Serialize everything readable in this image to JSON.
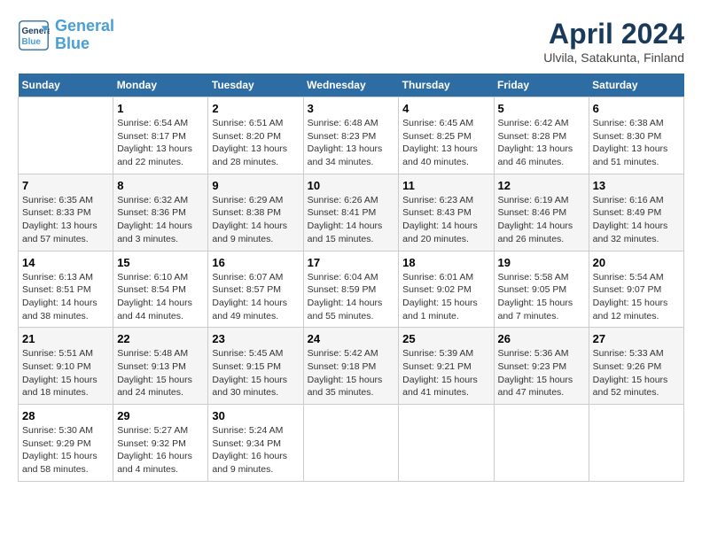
{
  "logo": {
    "line1": "General",
    "line2": "Blue"
  },
  "title": "April 2024",
  "subtitle": "Ulvila, Satakunta, Finland",
  "days_header": [
    "Sunday",
    "Monday",
    "Tuesday",
    "Wednesday",
    "Thursday",
    "Friday",
    "Saturday"
  ],
  "weeks": [
    [
      {
        "num": "",
        "info": ""
      },
      {
        "num": "1",
        "info": "Sunrise: 6:54 AM\nSunset: 8:17 PM\nDaylight: 13 hours\nand 22 minutes."
      },
      {
        "num": "2",
        "info": "Sunrise: 6:51 AM\nSunset: 8:20 PM\nDaylight: 13 hours\nand 28 minutes."
      },
      {
        "num": "3",
        "info": "Sunrise: 6:48 AM\nSunset: 8:23 PM\nDaylight: 13 hours\nand 34 minutes."
      },
      {
        "num": "4",
        "info": "Sunrise: 6:45 AM\nSunset: 8:25 PM\nDaylight: 13 hours\nand 40 minutes."
      },
      {
        "num": "5",
        "info": "Sunrise: 6:42 AM\nSunset: 8:28 PM\nDaylight: 13 hours\nand 46 minutes."
      },
      {
        "num": "6",
        "info": "Sunrise: 6:38 AM\nSunset: 8:30 PM\nDaylight: 13 hours\nand 51 minutes."
      }
    ],
    [
      {
        "num": "7",
        "info": "Sunrise: 6:35 AM\nSunset: 8:33 PM\nDaylight: 13 hours\nand 57 minutes."
      },
      {
        "num": "8",
        "info": "Sunrise: 6:32 AM\nSunset: 8:36 PM\nDaylight: 14 hours\nand 3 minutes."
      },
      {
        "num": "9",
        "info": "Sunrise: 6:29 AM\nSunset: 8:38 PM\nDaylight: 14 hours\nand 9 minutes."
      },
      {
        "num": "10",
        "info": "Sunrise: 6:26 AM\nSunset: 8:41 PM\nDaylight: 14 hours\nand 15 minutes."
      },
      {
        "num": "11",
        "info": "Sunrise: 6:23 AM\nSunset: 8:43 PM\nDaylight: 14 hours\nand 20 minutes."
      },
      {
        "num": "12",
        "info": "Sunrise: 6:19 AM\nSunset: 8:46 PM\nDaylight: 14 hours\nand 26 minutes."
      },
      {
        "num": "13",
        "info": "Sunrise: 6:16 AM\nSunset: 8:49 PM\nDaylight: 14 hours\nand 32 minutes."
      }
    ],
    [
      {
        "num": "14",
        "info": "Sunrise: 6:13 AM\nSunset: 8:51 PM\nDaylight: 14 hours\nand 38 minutes."
      },
      {
        "num": "15",
        "info": "Sunrise: 6:10 AM\nSunset: 8:54 PM\nDaylight: 14 hours\nand 44 minutes."
      },
      {
        "num": "16",
        "info": "Sunrise: 6:07 AM\nSunset: 8:57 PM\nDaylight: 14 hours\nand 49 minutes."
      },
      {
        "num": "17",
        "info": "Sunrise: 6:04 AM\nSunset: 8:59 PM\nDaylight: 14 hours\nand 55 minutes."
      },
      {
        "num": "18",
        "info": "Sunrise: 6:01 AM\nSunset: 9:02 PM\nDaylight: 15 hours\nand 1 minute."
      },
      {
        "num": "19",
        "info": "Sunrise: 5:58 AM\nSunset: 9:05 PM\nDaylight: 15 hours\nand 7 minutes."
      },
      {
        "num": "20",
        "info": "Sunrise: 5:54 AM\nSunset: 9:07 PM\nDaylight: 15 hours\nand 12 minutes."
      }
    ],
    [
      {
        "num": "21",
        "info": "Sunrise: 5:51 AM\nSunset: 9:10 PM\nDaylight: 15 hours\nand 18 minutes."
      },
      {
        "num": "22",
        "info": "Sunrise: 5:48 AM\nSunset: 9:13 PM\nDaylight: 15 hours\nand 24 minutes."
      },
      {
        "num": "23",
        "info": "Sunrise: 5:45 AM\nSunset: 9:15 PM\nDaylight: 15 hours\nand 30 minutes."
      },
      {
        "num": "24",
        "info": "Sunrise: 5:42 AM\nSunset: 9:18 PM\nDaylight: 15 hours\nand 35 minutes."
      },
      {
        "num": "25",
        "info": "Sunrise: 5:39 AM\nSunset: 9:21 PM\nDaylight: 15 hours\nand 41 minutes."
      },
      {
        "num": "26",
        "info": "Sunrise: 5:36 AM\nSunset: 9:23 PM\nDaylight: 15 hours\nand 47 minutes."
      },
      {
        "num": "27",
        "info": "Sunrise: 5:33 AM\nSunset: 9:26 PM\nDaylight: 15 hours\nand 52 minutes."
      }
    ],
    [
      {
        "num": "28",
        "info": "Sunrise: 5:30 AM\nSunset: 9:29 PM\nDaylight: 15 hours\nand 58 minutes."
      },
      {
        "num": "29",
        "info": "Sunrise: 5:27 AM\nSunset: 9:32 PM\nDaylight: 16 hours\nand 4 minutes."
      },
      {
        "num": "30",
        "info": "Sunrise: 5:24 AM\nSunset: 9:34 PM\nDaylight: 16 hours\nand 9 minutes."
      },
      {
        "num": "",
        "info": ""
      },
      {
        "num": "",
        "info": ""
      },
      {
        "num": "",
        "info": ""
      },
      {
        "num": "",
        "info": ""
      }
    ]
  ]
}
